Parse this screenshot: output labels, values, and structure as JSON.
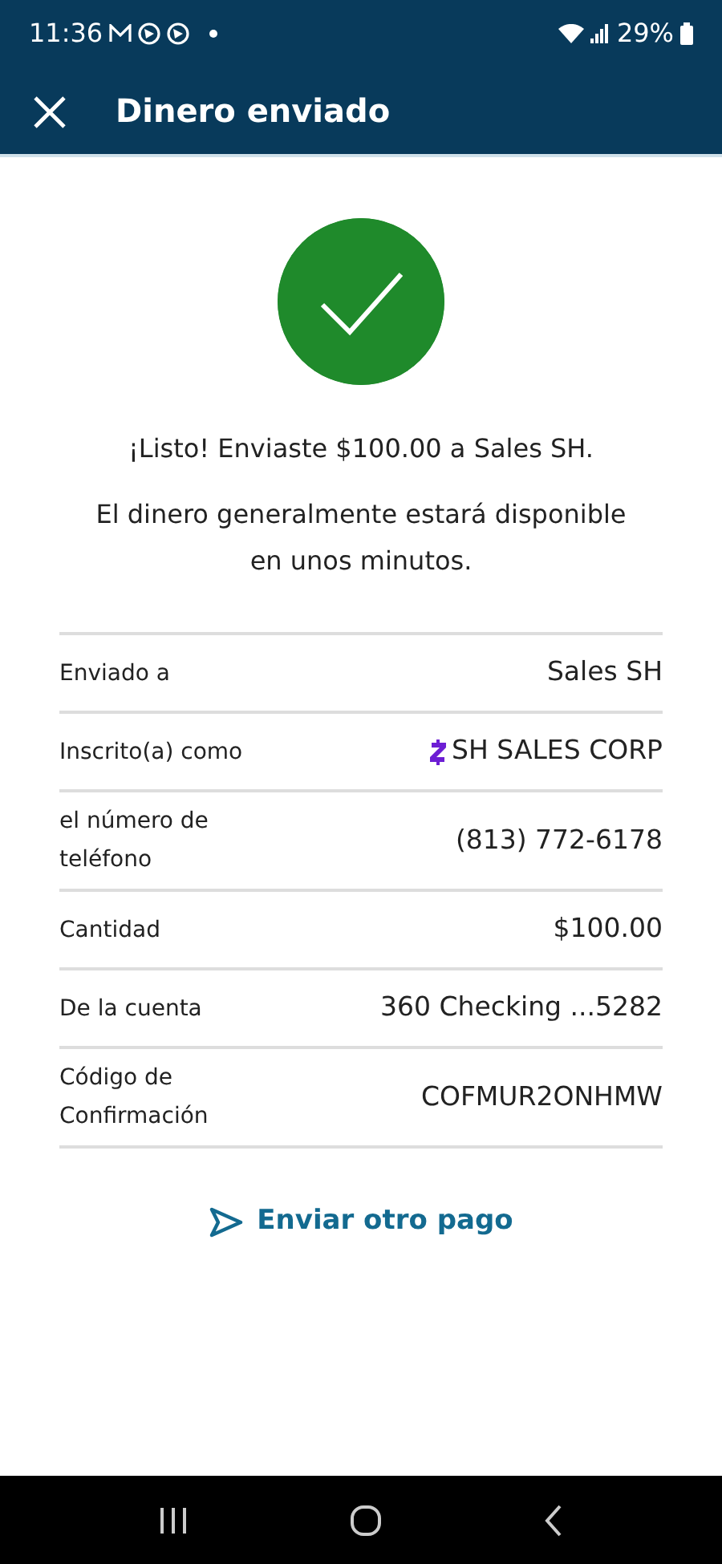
{
  "status_bar": {
    "time": "11:36",
    "battery": "29%"
  },
  "app_bar": {
    "title": "Dinero enviado"
  },
  "message": "¡Listo! Enviaste $100.00 a Sales SH.",
  "note": "El dinero generalmente estará disponible en unos minutos.",
  "details": [
    {
      "kind": "plain",
      "label": "Enviado a",
      "value": "Sales SH"
    },
    {
      "kind": "enrolled",
      "label": "Inscrito(a) como",
      "value": "SH SALES CORP"
    },
    {
      "kind": "plain",
      "label": "el número de teléfono",
      "value": "(813) 772-6178"
    },
    {
      "kind": "plain",
      "label": "Cantidad",
      "value": "$100.00"
    },
    {
      "kind": "plain",
      "label": "De la cuenta",
      "value": "360 Checking ...5282"
    },
    {
      "kind": "plain",
      "label": "Código de Confirmación",
      "value": "COFMUR2ONHMW"
    }
  ],
  "action": {
    "label": "Enviar otro pago"
  }
}
